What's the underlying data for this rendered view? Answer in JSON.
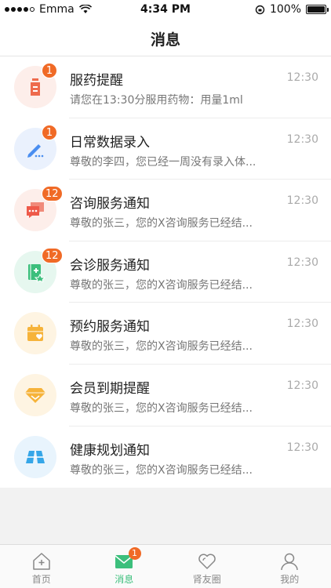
{
  "status_bar": {
    "carrier": "Emma",
    "time": "4:34 PM",
    "battery": "100%"
  },
  "header": {
    "title": "消息"
  },
  "messages": [
    {
      "title": "服药提醒",
      "desc": "请您在13:30分服用药物：用量1ml",
      "time": "12:30",
      "badge": "1",
      "icon": "medicine-icon",
      "bg": "#fdeeea",
      "color": "#ee6b4d"
    },
    {
      "title": "日常数据录入",
      "desc": "尊敬的李四，您已经一周没有录入体...",
      "time": "12:30",
      "badge": "1",
      "icon": "pen-icon",
      "bg": "#eaf1fd",
      "color": "#4a8ef0"
    },
    {
      "title": "咨询服务通知",
      "desc": "尊敬的张三，您的X咨询服务已经结...",
      "time": "12:30",
      "badge": "12",
      "icon": "chat-icon",
      "bg": "#fdeeea",
      "color": "#ee5a4a"
    },
    {
      "title": "会诊服务通知",
      "desc": "尊敬的张三，您的X咨询服务已经结...",
      "time": "12:30",
      "badge": "12",
      "icon": "consult-book-icon",
      "bg": "#e6f7ef",
      "color": "#3cbf7c"
    },
    {
      "title": "预约服务通知",
      "desc": "尊敬的张三，您的X咨询服务已经结...",
      "time": "12:30",
      "badge": "",
      "icon": "calendar-heart-icon",
      "bg": "#fef4e2",
      "color": "#f6b33a"
    },
    {
      "title": "会员到期提醒",
      "desc": "尊敬的张三，您的X咨询服务已经结...",
      "time": "12:30",
      "badge": "",
      "icon": "diamond-icon",
      "bg": "#fef4e2",
      "color": "#f6b33a"
    },
    {
      "title": "健康规划通知",
      "desc": "尊敬的张三，您的X咨询服务已经结...",
      "time": "12:30",
      "badge": "",
      "icon": "map-icon",
      "bg": "#e8f4fd",
      "color": "#35a6e8"
    }
  ],
  "tabs": [
    {
      "label": "首页",
      "icon": "home-icon",
      "active": false,
      "badge": ""
    },
    {
      "label": "消息",
      "icon": "mail-icon",
      "active": true,
      "badge": "1"
    },
    {
      "label": "肾友圈",
      "icon": "heart-icon",
      "active": false,
      "badge": ""
    },
    {
      "label": "我的",
      "icon": "user-icon",
      "active": false,
      "badge": ""
    }
  ]
}
